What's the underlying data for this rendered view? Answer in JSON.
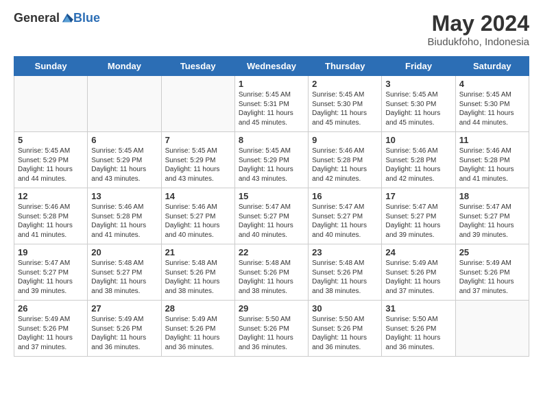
{
  "header": {
    "logo_general": "General",
    "logo_blue": "Blue",
    "title": "May 2024",
    "location": "Biudukfoho, Indonesia"
  },
  "days_of_week": [
    "Sunday",
    "Monday",
    "Tuesday",
    "Wednesday",
    "Thursday",
    "Friday",
    "Saturday"
  ],
  "weeks": [
    [
      {
        "day": "",
        "empty": true
      },
      {
        "day": "",
        "empty": true
      },
      {
        "day": "",
        "empty": true
      },
      {
        "day": "1",
        "sunrise": "5:45 AM",
        "sunset": "5:31 PM",
        "daylight": "11 hours and 45 minutes."
      },
      {
        "day": "2",
        "sunrise": "5:45 AM",
        "sunset": "5:30 PM",
        "daylight": "11 hours and 45 minutes."
      },
      {
        "day": "3",
        "sunrise": "5:45 AM",
        "sunset": "5:30 PM",
        "daylight": "11 hours and 45 minutes."
      },
      {
        "day": "4",
        "sunrise": "5:45 AM",
        "sunset": "5:30 PM",
        "daylight": "11 hours and 44 minutes."
      }
    ],
    [
      {
        "day": "5",
        "sunrise": "5:45 AM",
        "sunset": "5:29 PM",
        "daylight": "11 hours and 44 minutes."
      },
      {
        "day": "6",
        "sunrise": "5:45 AM",
        "sunset": "5:29 PM",
        "daylight": "11 hours and 43 minutes."
      },
      {
        "day": "7",
        "sunrise": "5:45 AM",
        "sunset": "5:29 PM",
        "daylight": "11 hours and 43 minutes."
      },
      {
        "day": "8",
        "sunrise": "5:45 AM",
        "sunset": "5:29 PM",
        "daylight": "11 hours and 43 minutes."
      },
      {
        "day": "9",
        "sunrise": "5:46 AM",
        "sunset": "5:28 PM",
        "daylight": "11 hours and 42 minutes."
      },
      {
        "day": "10",
        "sunrise": "5:46 AM",
        "sunset": "5:28 PM",
        "daylight": "11 hours and 42 minutes."
      },
      {
        "day": "11",
        "sunrise": "5:46 AM",
        "sunset": "5:28 PM",
        "daylight": "11 hours and 41 minutes."
      }
    ],
    [
      {
        "day": "12",
        "sunrise": "5:46 AM",
        "sunset": "5:28 PM",
        "daylight": "11 hours and 41 minutes."
      },
      {
        "day": "13",
        "sunrise": "5:46 AM",
        "sunset": "5:28 PM",
        "daylight": "11 hours and 41 minutes."
      },
      {
        "day": "14",
        "sunrise": "5:46 AM",
        "sunset": "5:27 PM",
        "daylight": "11 hours and 40 minutes."
      },
      {
        "day": "15",
        "sunrise": "5:47 AM",
        "sunset": "5:27 PM",
        "daylight": "11 hours and 40 minutes."
      },
      {
        "day": "16",
        "sunrise": "5:47 AM",
        "sunset": "5:27 PM",
        "daylight": "11 hours and 40 minutes."
      },
      {
        "day": "17",
        "sunrise": "5:47 AM",
        "sunset": "5:27 PM",
        "daylight": "11 hours and 39 minutes."
      },
      {
        "day": "18",
        "sunrise": "5:47 AM",
        "sunset": "5:27 PM",
        "daylight": "11 hours and 39 minutes."
      }
    ],
    [
      {
        "day": "19",
        "sunrise": "5:47 AM",
        "sunset": "5:27 PM",
        "daylight": "11 hours and 39 minutes."
      },
      {
        "day": "20",
        "sunrise": "5:48 AM",
        "sunset": "5:27 PM",
        "daylight": "11 hours and 38 minutes."
      },
      {
        "day": "21",
        "sunrise": "5:48 AM",
        "sunset": "5:26 PM",
        "daylight": "11 hours and 38 minutes."
      },
      {
        "day": "22",
        "sunrise": "5:48 AM",
        "sunset": "5:26 PM",
        "daylight": "11 hours and 38 minutes."
      },
      {
        "day": "23",
        "sunrise": "5:48 AM",
        "sunset": "5:26 PM",
        "daylight": "11 hours and 38 minutes."
      },
      {
        "day": "24",
        "sunrise": "5:49 AM",
        "sunset": "5:26 PM",
        "daylight": "11 hours and 37 minutes."
      },
      {
        "day": "25",
        "sunrise": "5:49 AM",
        "sunset": "5:26 PM",
        "daylight": "11 hours and 37 minutes."
      }
    ],
    [
      {
        "day": "26",
        "sunrise": "5:49 AM",
        "sunset": "5:26 PM",
        "daylight": "11 hours and 37 minutes."
      },
      {
        "day": "27",
        "sunrise": "5:49 AM",
        "sunset": "5:26 PM",
        "daylight": "11 hours and 36 minutes."
      },
      {
        "day": "28",
        "sunrise": "5:49 AM",
        "sunset": "5:26 PM",
        "daylight": "11 hours and 36 minutes."
      },
      {
        "day": "29",
        "sunrise": "5:50 AM",
        "sunset": "5:26 PM",
        "daylight": "11 hours and 36 minutes."
      },
      {
        "day": "30",
        "sunrise": "5:50 AM",
        "sunset": "5:26 PM",
        "daylight": "11 hours and 36 minutes."
      },
      {
        "day": "31",
        "sunrise": "5:50 AM",
        "sunset": "5:26 PM",
        "daylight": "11 hours and 36 minutes."
      },
      {
        "day": "",
        "empty": true
      }
    ]
  ],
  "labels": {
    "sunrise": "Sunrise:",
    "sunset": "Sunset:",
    "daylight": "Daylight:"
  }
}
